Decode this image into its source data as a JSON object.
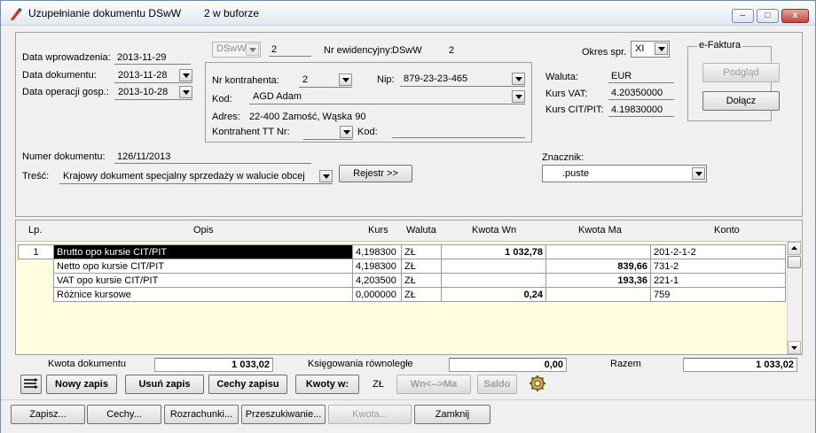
{
  "window": {
    "title": "Uzupełnianie dokumentu DSwW",
    "buffer_label": "2 w buforze",
    "controls": {
      "minimize": "–",
      "maximize": "□",
      "close": "x"
    }
  },
  "header": {
    "data_wprowadzenia_label": "Data wprowadzenia:",
    "data_wprowadzenia": "2013-11-29",
    "data_dokumentu_label": "Data dokumentu:",
    "data_dokumentu": "2013-11-28",
    "data_operacji_label": "Data operacji gosp.:",
    "data_operacji": "2013-10-28",
    "doc_type": "DSwW",
    "doc_number": "2",
    "nr_ewidencyjny_label": "Nr ewidencyjny:",
    "nr_ewidencyjny_type": "DSwW",
    "nr_ewidencyjny_number": "2",
    "okres_label": "Okres spr.",
    "okres": "XI",
    "numer_dokumentu_label": "Numer dokumentu:",
    "numer_dokumentu": "126/11/2013",
    "tresc_label": "Treść:",
    "tresc": "Krajowy dokument specjalny sprzedaży w walucie obcej",
    "rejestr_button": "Rejestr >>"
  },
  "kontrahent": {
    "nr_label": "Nr kontrahenta:",
    "nr": "2",
    "nip_label": "Nip:",
    "nip": "879-23-23-465",
    "kod_label": "Kod:",
    "kod": "AGD Adam",
    "adres_label": "Adres:",
    "adres": "22-400 Zamość, Wąska 90",
    "tt_label": "Kontrahent TT Nr:",
    "tt_nr": "",
    "tt_kod_label": "Kod:",
    "tt_kod": ""
  },
  "waluta": {
    "waluta_label": "Waluta:",
    "waluta": "EUR",
    "kurs_vat_label": "Kurs VAT:",
    "kurs_vat": "4.20350000",
    "kurs_cit_label": "Kurs CIT/PIT:",
    "kurs_cit": "4.19830000"
  },
  "efaktura": {
    "title": "e-Faktura",
    "podglad_button": "Podgląd",
    "dolacz_button": "Dołącz"
  },
  "znacznik": {
    "label": "Znacznik:",
    "value": ".puste"
  },
  "grid": {
    "columns": [
      "Lp.",
      "Opis",
      "Kurs",
      "Waluta",
      "Kwota Wn",
      "Kwota Ma",
      "Konto"
    ],
    "rows": [
      {
        "lp": "1",
        "opis": "Brutto opo kursie CIT/PIT",
        "kurs": "4,198300",
        "waluta": "ZŁ",
        "wn": "1 032,78",
        "ma": "",
        "konto": "201-2-1-2"
      },
      {
        "lp": "",
        "opis": "Netto opo kursie CIT/PIT",
        "kurs": "4,198300",
        "waluta": "ZŁ",
        "wn": "",
        "ma": "839,66",
        "konto": "731-2"
      },
      {
        "lp": "",
        "opis": "VAT opo kursie CIT/PIT",
        "kurs": "4,203500",
        "waluta": "ZŁ",
        "wn": "",
        "ma": "193,36",
        "konto": "221-1"
      },
      {
        "lp": "",
        "opis": "Różnice kursowe",
        "kurs": "0,000000",
        "waluta": "ZŁ",
        "wn": "0,24",
        "ma": "",
        "konto": "759"
      }
    ]
  },
  "totals": {
    "kwota_label": "Kwota dokumentu",
    "kwota": "1 033,02",
    "ksiegowania_label": "Księgowania równoległe",
    "ksiegowania": "0,00",
    "razem_label": "Razem",
    "razem": "1 033,02"
  },
  "toolbar": {
    "nowy_zapis": "Nowy zapis",
    "usun_zapis": "Usuń zapis",
    "cechy_zapisu": "Cechy zapisu",
    "kwoty_w": "Kwoty w:",
    "currency": "ZŁ",
    "wn_ma": "Wn<-->Ma",
    "saldo": "Saldo"
  },
  "bottom": {
    "zapisz": "Zapisz...",
    "cechy": "Cechy...",
    "rozrachunki": "Rozrachunki...",
    "przeszukiwanie": "Przeszukiwanie...",
    "kwota": "Kwota...",
    "zamknij": "Zamknij"
  },
  "colors": {
    "grid_background": "#fffce0",
    "selection": "#000000",
    "window_bg": "#f0f0f0"
  },
  "icons": [
    "app-pen-icon",
    "menu-lines-icon",
    "calculator-gear-icon",
    "dropdown-arrow-icon"
  ]
}
